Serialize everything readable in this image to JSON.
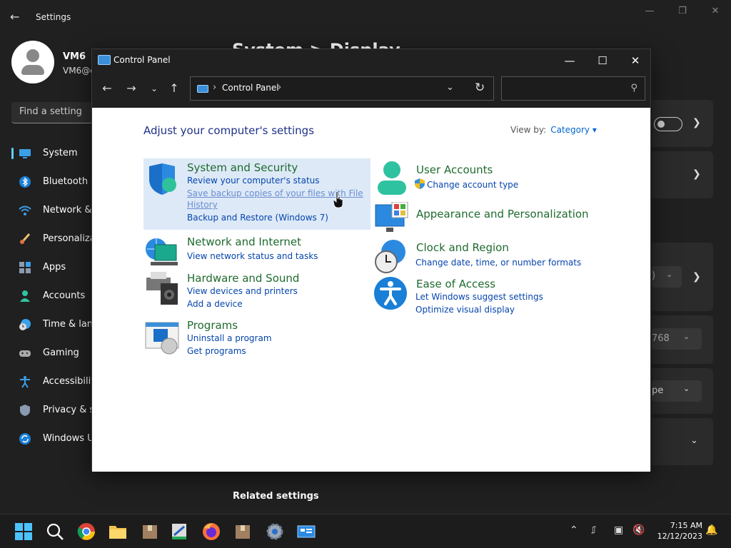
{
  "settings": {
    "title": "Settings",
    "user_name": "VM6",
    "user_email": "VM6@c",
    "find_placeholder": "Find a setting",
    "page_title": "System > Display",
    "nav": [
      {
        "label": "System"
      },
      {
        "label": "Bluetooth &"
      },
      {
        "label": "Network &"
      },
      {
        "label": "Personaliza"
      },
      {
        "label": "Apps"
      },
      {
        "label": "Accounts"
      },
      {
        "label": "Time & lan"
      },
      {
        "label": "Gaming"
      },
      {
        "label": "Accessibilit"
      },
      {
        "label": "Privacy & s"
      },
      {
        "label": "Windows U"
      }
    ],
    "partial_values": {
      "scale": ")",
      "resolution": "768",
      "orientation": "pe"
    },
    "related_settings": "Related settings"
  },
  "control_panel": {
    "window_title": "Control Panel",
    "address_crumb": "Control Panel",
    "search_placeholder": "",
    "heading": "Adjust your computer's settings",
    "view_by_label": "View by:",
    "view_by_value": "Category",
    "left_categories": [
      {
        "title": "System and Security",
        "links": [
          "Review your computer's status",
          "Save backup copies of your files with File",
          "History",
          "Backup and Restore (Windows 7)"
        ]
      },
      {
        "title": "Network and Internet",
        "links": [
          "View network status and tasks"
        ]
      },
      {
        "title": "Hardware and Sound",
        "links": [
          "View devices and printers",
          "Add a device"
        ]
      },
      {
        "title": "Programs",
        "links": [
          "Uninstall a program",
          "Get programs"
        ]
      }
    ],
    "right_categories": [
      {
        "title": "User Accounts",
        "links": [
          "Change account type"
        ]
      },
      {
        "title": "Appearance and Personalization",
        "links": []
      },
      {
        "title": "Clock and Region",
        "links": [
          "Change date, time, or number formats"
        ]
      },
      {
        "title": "Ease of Access",
        "links": [
          "Let Windows suggest settings",
          "Optimize visual display"
        ]
      }
    ]
  },
  "taskbar": {
    "time": "7:15 AM",
    "date": "12/12/2023"
  },
  "colors": {
    "accent": "#60cdff",
    "cp_title_green": "#1e6b2e",
    "cp_link_blue": "#0645ad",
    "cp_heading_blue": "#1e3287"
  }
}
